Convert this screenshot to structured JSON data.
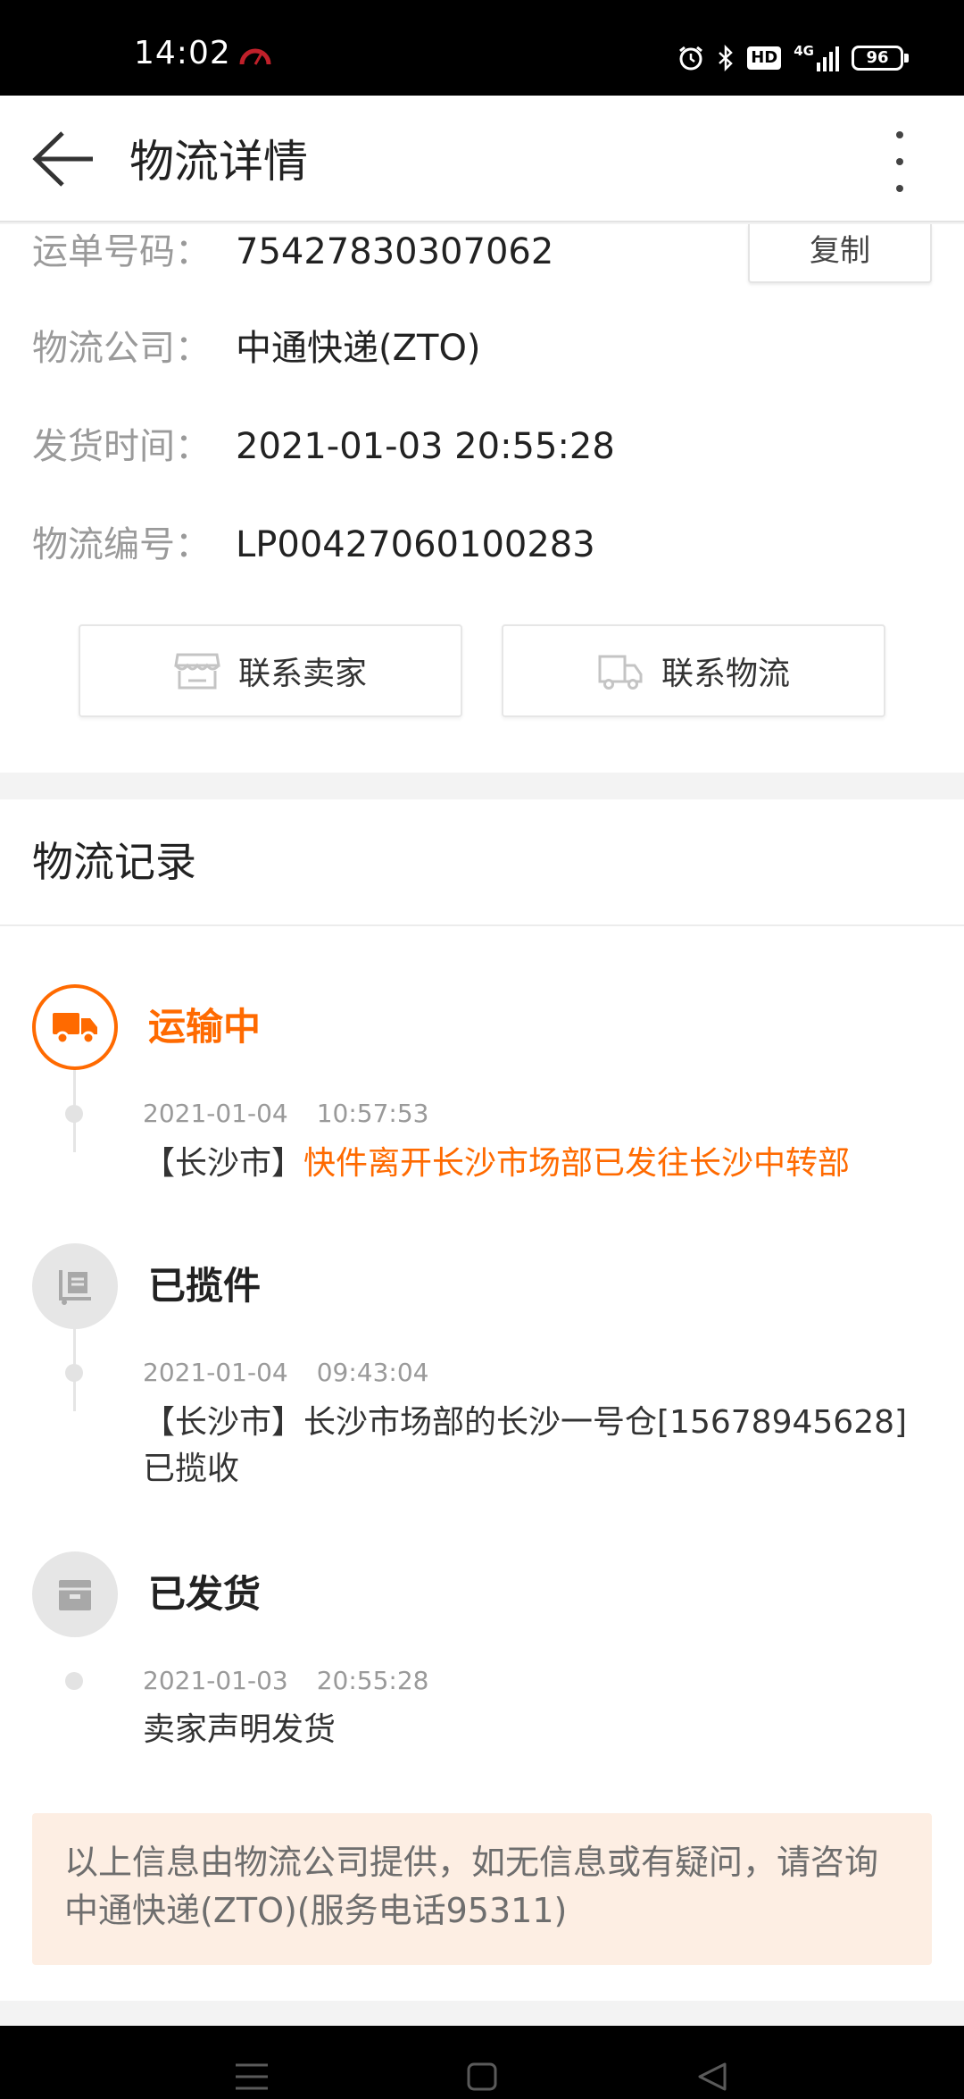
{
  "status_bar": {
    "time": "14:02",
    "icons": [
      "speed-icon",
      "alarm-icon",
      "bluetooth-icon",
      "hd-icon",
      "signal-icon",
      "battery-icon"
    ],
    "hd": "HD",
    "network": "4G",
    "battery": "96"
  },
  "header": {
    "title": "物流详情",
    "back_icon": "back-arrow-icon",
    "more_icon": "more-vertical-icon"
  },
  "info": {
    "tracking_label": "运单号码：",
    "tracking_value": "75427830307062",
    "copy_label": "复制",
    "company_label": "物流公司：",
    "company_value": "中通快递(ZTO)",
    "ship_time_label": "发货时间：",
    "ship_time_value": "2021-01-03 20:55:28",
    "logistics_no_label": "物流编号：",
    "logistics_no_value": "LP00427060100283",
    "contact_seller_label": "联系卖家",
    "contact_logistics_label": "联系物流"
  },
  "records": {
    "title": "物流记录",
    "items": [
      {
        "status": "运输中",
        "icon": "delivery-truck-icon",
        "active": true,
        "date": "2021-01-04",
        "time": "10:57:53",
        "city": "【长沙市】",
        "desc": "快件离开长沙市场部已发往长沙中转部"
      },
      {
        "status": "已揽件",
        "icon": "pickup-icon",
        "active": false,
        "date": "2021-01-04",
        "time": "09:43:04",
        "city": "【长沙市】",
        "desc": "长沙市场部的长沙一号仓[15678945628]已揽收"
      },
      {
        "status": "已发货",
        "icon": "box-icon",
        "active": false,
        "date": "2021-01-03",
        "time": "20:55:28",
        "desc": "卖家声明发货"
      }
    ],
    "notice": "以上信息由物流公司提供，如无信息或有疑问，请咨询 中通快递(ZTO)(服务电话95311)"
  },
  "colors": {
    "accent": "#ff6a00",
    "notice_bg": "#fdeee3",
    "label_gray": "#9a9a9a"
  }
}
